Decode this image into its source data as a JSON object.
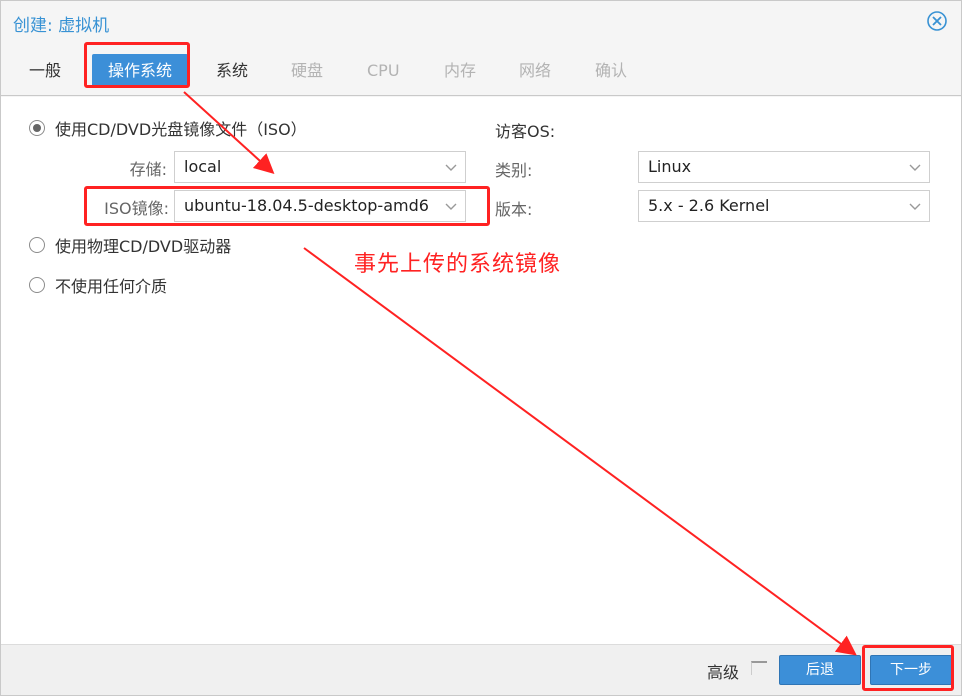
{
  "window": {
    "title": "创建: 虚拟机"
  },
  "tabs": [
    {
      "label": "一般",
      "state": "normal"
    },
    {
      "label": "操作系统",
      "state": "active"
    },
    {
      "label": "系统",
      "state": "normal"
    },
    {
      "label": "硬盘",
      "state": "disabled"
    },
    {
      "label": "CPU",
      "state": "disabled"
    },
    {
      "label": "内存",
      "state": "disabled"
    },
    {
      "label": "网络",
      "state": "disabled"
    },
    {
      "label": "确认",
      "state": "disabled"
    }
  ],
  "media": {
    "use_iso_label": "使用CD/DVD光盘镜像文件（ISO）",
    "storage_label": "存储:",
    "storage_value": "local",
    "iso_label": "ISO镜像:",
    "iso_value": "ubuntu-18.04.5-desktop-amd64",
    "physical_label": "使用物理CD/DVD驱动器",
    "none_label": "不使用任何介质"
  },
  "guest_os": {
    "heading": "访客OS:",
    "type_label": "类别:",
    "type_value": "Linux",
    "version_label": "版本:",
    "version_value": "5.x - 2.6 Kernel"
  },
  "annotation": {
    "note": "事先上传的系统镜像"
  },
  "footer": {
    "advanced_label": "高级",
    "back_label": "后退",
    "next_label": "下一步"
  },
  "colors": {
    "accent": "#3c8fd8",
    "title": "#3892d4",
    "annotation": "#ff2222"
  }
}
